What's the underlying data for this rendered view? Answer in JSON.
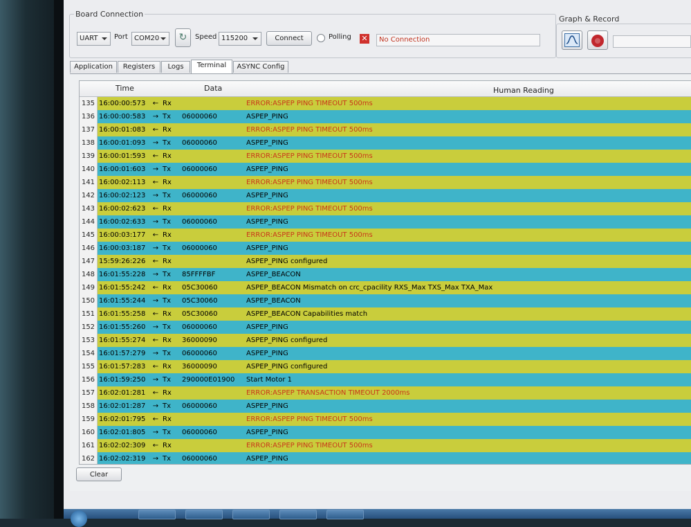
{
  "board_connection": {
    "title": "Board Connection",
    "interface": "UART",
    "port_label": "Port",
    "port": "COM20",
    "speed_label": "Speed",
    "speed": "115200",
    "connect_label": "Connect",
    "polling_label": "Polling",
    "status": "No Connection"
  },
  "graph_record": {
    "title": "Graph & Record"
  },
  "tabs": [
    {
      "label": "Application"
    },
    {
      "label": "Registers"
    },
    {
      "label": "Logs"
    },
    {
      "label": "Terminal"
    },
    {
      "label": "ASYNC Config"
    }
  ],
  "active_tab": "Terminal",
  "table": {
    "columns": {
      "time": "Time",
      "data": "Data",
      "reading": "Human Reading"
    },
    "rows": [
      {
        "n": "135",
        "time": "16:00:00:573",
        "dir": "Rx",
        "data": "",
        "reading": "ERROR:ASPEP PING TIMEOUT 500ms",
        "error": true
      },
      {
        "n": "136",
        "time": "16:00:00:583",
        "dir": "Tx",
        "data": "06000060",
        "reading": "ASPEP_PING",
        "error": false
      },
      {
        "n": "137",
        "time": "16:00:01:083",
        "dir": "Rx",
        "data": "",
        "reading": "ERROR:ASPEP PING TIMEOUT 500ms",
        "error": true
      },
      {
        "n": "138",
        "time": "16:00:01:093",
        "dir": "Tx",
        "data": "06000060",
        "reading": "ASPEP_PING",
        "error": false
      },
      {
        "n": "139",
        "time": "16:00:01:593",
        "dir": "Rx",
        "data": "",
        "reading": "ERROR:ASPEP PING TIMEOUT 500ms",
        "error": true
      },
      {
        "n": "140",
        "time": "16:00:01:603",
        "dir": "Tx",
        "data": "06000060",
        "reading": "ASPEP_PING",
        "error": false
      },
      {
        "n": "141",
        "time": "16:00:02:113",
        "dir": "Rx",
        "data": "",
        "reading": "ERROR:ASPEP PING TIMEOUT 500ms",
        "error": true
      },
      {
        "n": "142",
        "time": "16:00:02:123",
        "dir": "Tx",
        "data": "06000060",
        "reading": "ASPEP_PING",
        "error": false
      },
      {
        "n": "143",
        "time": "16:00:02:623",
        "dir": "Rx",
        "data": "",
        "reading": "ERROR:ASPEP PING TIMEOUT 500ms",
        "error": true
      },
      {
        "n": "144",
        "time": "16:00:02:633",
        "dir": "Tx",
        "data": "06000060",
        "reading": "ASPEP_PING",
        "error": false
      },
      {
        "n": "145",
        "time": "16:00:03:177",
        "dir": "Rx",
        "data": "",
        "reading": "ERROR:ASPEP PING TIMEOUT 500ms",
        "error": true
      },
      {
        "n": "146",
        "time": "16:00:03:187",
        "dir": "Tx",
        "data": "06000060",
        "reading": "ASPEP_PING",
        "error": false
      },
      {
        "n": "147",
        "time": "15:59:26:226",
        "dir": "Rx",
        "data": "",
        "reading": "ASPEP_PING configured",
        "error": false
      },
      {
        "n": "148",
        "time": "16:01:55:228",
        "dir": "Tx",
        "data": "85FFFFBF",
        "reading": "ASPEP_BEACON",
        "error": false
      },
      {
        "n": "149",
        "time": "16:01:55:242",
        "dir": "Rx",
        "data": "05C30060",
        "reading": "ASPEP_BEACON Mismatch on crc_cpacility  RXS_Max TXS_Max TXA_Max",
        "error": false
      },
      {
        "n": "150",
        "time": "16:01:55:244",
        "dir": "Tx",
        "data": "05C30060",
        "reading": "ASPEP_BEACON",
        "error": false
      },
      {
        "n": "151",
        "time": "16:01:55:258",
        "dir": "Rx",
        "data": "05C30060",
        "reading": "ASPEP_BEACON Capabilities match",
        "error": false
      },
      {
        "n": "152",
        "time": "16:01:55:260",
        "dir": "Tx",
        "data": "06000060",
        "reading": "ASPEP_PING",
        "error": false
      },
      {
        "n": "153",
        "time": "16:01:55:274",
        "dir": "Rx",
        "data": "36000090",
        "reading": "ASPEP_PING configured",
        "error": false
      },
      {
        "n": "154",
        "time": "16:01:57:279",
        "dir": "Tx",
        "data": "06000060",
        "reading": "ASPEP_PING",
        "error": false
      },
      {
        "n": "155",
        "time": "16:01:57:283",
        "dir": "Rx",
        "data": "36000090",
        "reading": "ASPEP_PING configured",
        "error": false
      },
      {
        "n": "156",
        "time": "16:01:59:250",
        "dir": "Tx",
        "data": "290000E01900",
        "reading": "Start Motor 1",
        "error": false
      },
      {
        "n": "157",
        "time": "16:02:01:281",
        "dir": "Rx",
        "data": "",
        "reading": "ERROR:ASPEP TRANSACTION TIMEOUT 2000ms",
        "error": true
      },
      {
        "n": "158",
        "time": "16:02:01:287",
        "dir": "Tx",
        "data": "06000060",
        "reading": "ASPEP_PING",
        "error": false
      },
      {
        "n": "159",
        "time": "16:02:01:795",
        "dir": "Rx",
        "data": "",
        "reading": "ERROR:ASPEP PING TIMEOUT 500ms",
        "error": true
      },
      {
        "n": "160",
        "time": "16:02:01:805",
        "dir": "Tx",
        "data": "06000060",
        "reading": "ASPEP_PING",
        "error": false
      },
      {
        "n": "161",
        "time": "16:02:02:309",
        "dir": "Rx",
        "data": "",
        "reading": "ERROR:ASPEP PING TIMEOUT 500ms",
        "error": true
      },
      {
        "n": "162",
        "time": "16:02:02:319",
        "dir": "Tx",
        "data": "06000060",
        "reading": "ASPEP_PING",
        "error": false
      }
    ]
  },
  "clear_label": "Clear",
  "colors": {
    "rx_row": "#c9cd3c",
    "tx_row": "#3fb4c9",
    "error_text": "#c9371a"
  }
}
